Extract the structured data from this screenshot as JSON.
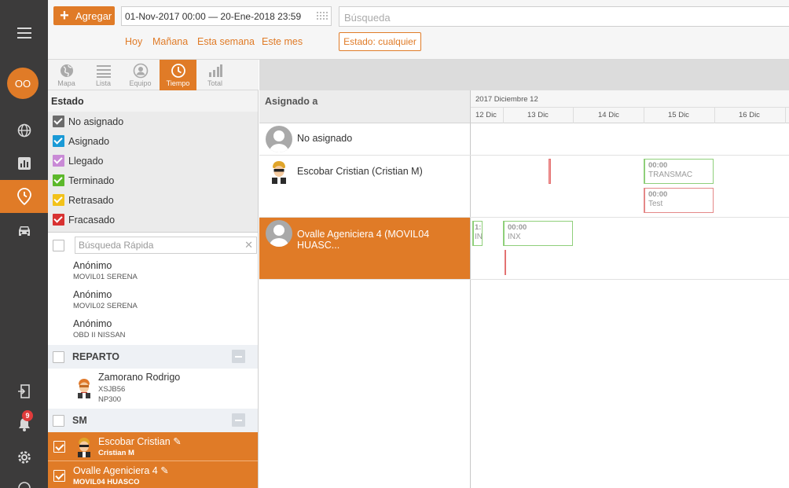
{
  "rail": {
    "user_initials": "OO",
    "notification_count": "9"
  },
  "toolbar": {
    "add_label": "Agregar",
    "date_range": "01-Nov-2017 00:00 — 20-Ene-2018 23:59",
    "search_placeholder": "Búsqueda",
    "quick_filters": [
      "Hoy",
      "Mañana",
      "Esta semana",
      "Este mes"
    ],
    "state_filter": "Estado: cualquier"
  },
  "view_tabs": [
    {
      "label": "Mapa",
      "icon": "globe-icon"
    },
    {
      "label": "Lista",
      "icon": "list-icon"
    },
    {
      "label": "Equipo",
      "icon": "user-icon"
    },
    {
      "label": "Tiempo",
      "icon": "clock-icon",
      "active": true
    },
    {
      "label": "Total",
      "icon": "bar-chart-icon"
    }
  ],
  "estado": {
    "title": "Estado",
    "items": [
      {
        "label": "No asignado",
        "color": "#6b6b6b"
      },
      {
        "label": "Asignado",
        "color": "#1a9ad6"
      },
      {
        "label": "Llegado",
        "color": "#c98ad6"
      },
      {
        "label": "Terminado",
        "color": "#5cb82b"
      },
      {
        "label": "Retrasado",
        "color": "#f2c21a"
      },
      {
        "label": "Fracasado",
        "color": "#d83232"
      }
    ]
  },
  "quick_search_placeholder": "Búsqueda Rápida",
  "anon": [
    {
      "name": "Anónimo",
      "sub": "MOVIL01 SERENA"
    },
    {
      "name": "Anónimo",
      "sub": "MOVIL02 SERENA"
    },
    {
      "name": "Anónimo",
      "sub": "OBD II NISSAN"
    }
  ],
  "groups": {
    "reparto": {
      "label": "REPARTO",
      "driver": {
        "name": "Zamorano Rodrigo",
        "sub1": "XSJB56",
        "sub2": "NP300"
      }
    },
    "sm": {
      "label": "SM",
      "selected": [
        {
          "name": "Escobar Cristian",
          "sub": "Cristian M"
        },
        {
          "name": "Ovalle Ageniciera 4",
          "sub": "MOVIL04 HUASCO"
        }
      ]
    }
  },
  "timeline": {
    "assigned_header": "Asignado a",
    "month_label": "2017 Diciembre 12",
    "days": [
      "12 Dic",
      "13 Dic",
      "14 Dic",
      "15 Dic",
      "16 Dic"
    ],
    "rows": [
      {
        "name": "No asignado"
      },
      {
        "name": "Escobar Cristian (Cristian M)"
      },
      {
        "name": "Ovalle Ageniciera 4 (MOVIL04 HUASC..."
      }
    ],
    "events": {
      "transmac": {
        "time": "00:00",
        "label": "TRANSMAC"
      },
      "test": {
        "time": "00:00",
        "label": "Test"
      },
      "partial": {
        "time": "1:",
        "label": "IN"
      },
      "inx": {
        "time": "00:00",
        "label": "INX"
      }
    }
  },
  "colors": {
    "accent": "#e07b27",
    "rail_bg": "#3c3b3b"
  }
}
